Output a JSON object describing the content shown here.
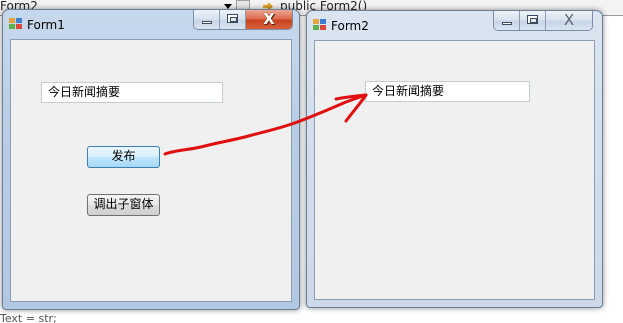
{
  "editor": {
    "type_combo": "Form2",
    "member_combo": "public Form2()",
    "bottom_hint": "Text = str;"
  },
  "form1": {
    "title": "Form1",
    "textbox_value": "今日新闻摘要",
    "publish_button": "发布",
    "open_child_button": "调出子窗体",
    "close_glyph": "X"
  },
  "form2": {
    "title": "Form2",
    "textbox_value": "今日新闻摘要",
    "close_glyph": "X"
  },
  "annotation": {
    "arrow_color": "#e01010"
  },
  "colors": {
    "form_background": "#f0f0f0",
    "active_caption": "#b9cde6",
    "inactive_caption": "#d3dfed",
    "close_button_active": "#d44a26"
  }
}
